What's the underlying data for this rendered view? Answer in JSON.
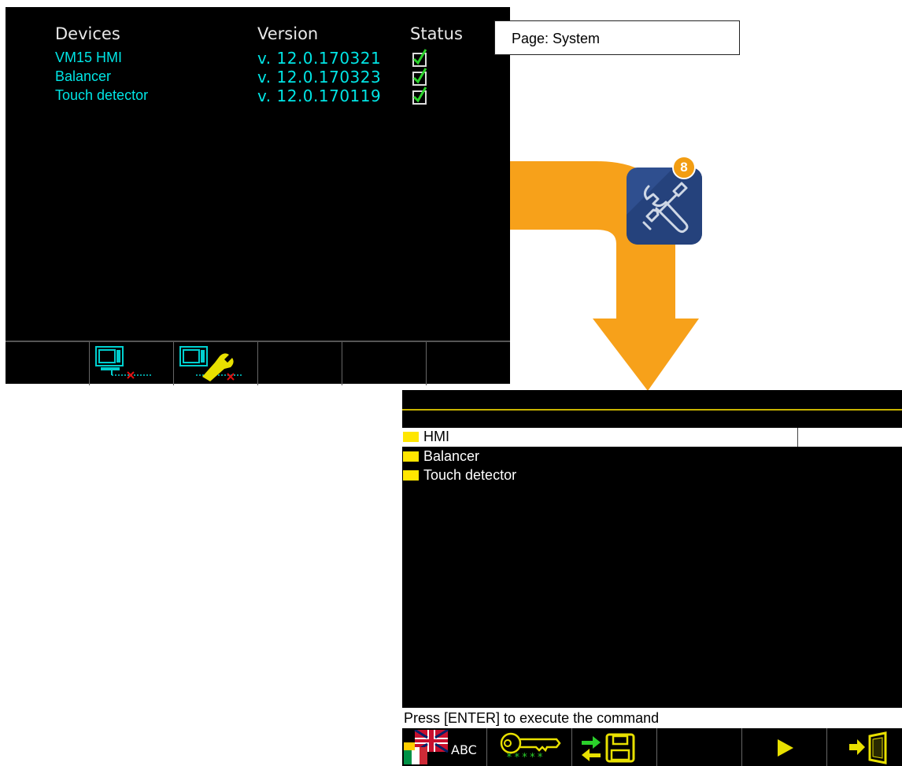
{
  "page_label": "Page: System",
  "screen1": {
    "headers": {
      "devices": "Devices",
      "version": "Version",
      "status": "Status"
    },
    "devices": [
      {
        "name": "VM15 HMI",
        "version": "v. 12.0.170321",
        "status": "checked"
      },
      {
        "name": "Balancer",
        "version": "v. 12.0.170323",
        "status": "checked"
      },
      {
        "name": "Touch detector",
        "version": "v. 12.0.170119",
        "status": "checked"
      }
    ],
    "toolbar_icons": [
      "monitor-disconnect-icon",
      "monitor-wrench-icon"
    ]
  },
  "app_icon": {
    "name": "wrench-screwdriver-icon",
    "badge": "8",
    "badge_color": "#f29d12",
    "tile_color": "#2f4f8f"
  },
  "screen2": {
    "folders": [
      "HMI",
      "Balancer",
      "Touch detector"
    ],
    "status": "Press [ENTER] to execute the command",
    "toolbar": {
      "language_label": "ABC",
      "password_mask": "*****"
    },
    "toolbar_icons": [
      "language-flags-icon",
      "key-password-icon",
      "transfer-save-icon",
      "play-icon",
      "exit-door-icon"
    ]
  },
  "colors": {
    "text_cyan": "#00e5e5",
    "folder_yellow": "#ffe600",
    "arrow_orange": "#f7a11a"
  }
}
